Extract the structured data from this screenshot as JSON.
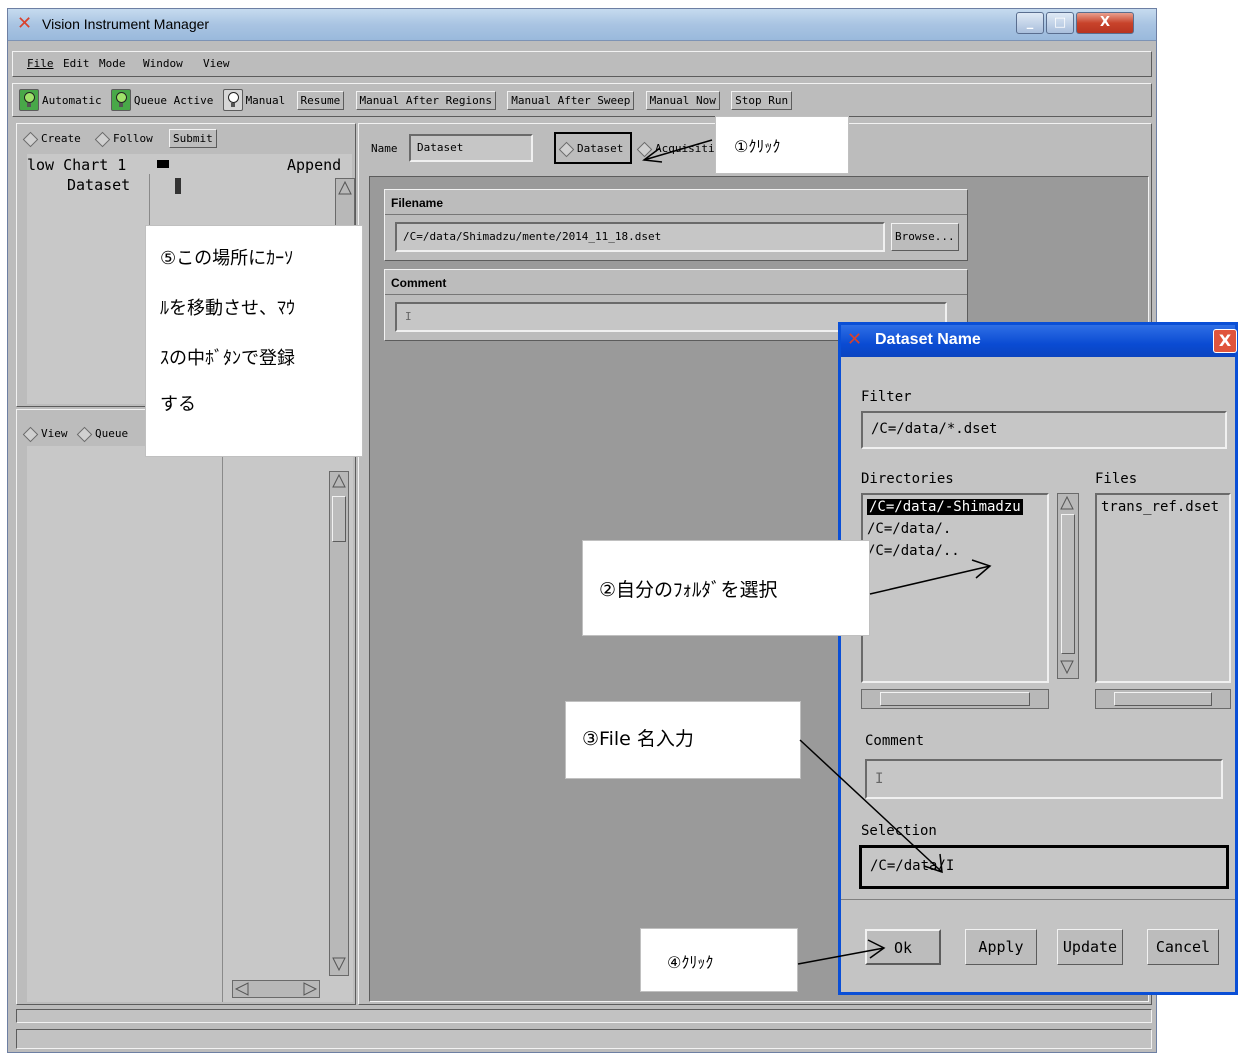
{
  "window": {
    "title": "Vision Instrument Manager",
    "buttons": {
      "minimize": "_",
      "maximize": "□",
      "close": "X"
    }
  },
  "menu": [
    "File",
    "Edit",
    "Mode",
    "Window",
    "View"
  ],
  "toolbar": {
    "automatic": "Automatic",
    "queue_active": "Queue Active",
    "manual": "Manual",
    "resume": "Resume",
    "manual_after_regions": "Manual After Regions",
    "manual_after_sweep": "Manual After Sweep",
    "manual_now": "Manual Now",
    "stop_run": "Stop Run"
  },
  "left_top": {
    "create": "Create",
    "follow": "Follow",
    "submit": "Submit",
    "list_items": [
      {
        "name": "low Chart 1",
        "value": "Append"
      },
      {
        "name": "Dataset",
        "value": ""
      }
    ]
  },
  "left_bottom": {
    "view": "View",
    "queue": "Queue"
  },
  "editor": {
    "name_label": "Name",
    "name_value": "Dataset",
    "dataset_radio": "Dataset",
    "acquisition_radio": "Acquisiti",
    "filename_title": "Filename",
    "filename_value": "/C=/data/Shimadzu/mente/2014_11_18.dset",
    "browse": "Browse...",
    "comment_title": "Comment",
    "comment_value": "I"
  },
  "dialog": {
    "title": "Dataset Name",
    "close": "X",
    "filter_label": "Filter",
    "filter_value": "/C=/data/*.dset",
    "directories_label": "Directories",
    "directories": [
      "/C=/data/-Shimadzu",
      "/C=/data/.",
      "/C=/data/.."
    ],
    "files_label": "Files",
    "files": [
      "trans_ref.dset"
    ],
    "comment_label": "Comment",
    "comment_value": "I",
    "selection_label": "Selection",
    "selection_value": "/C=/data/I",
    "ok": "Ok",
    "apply": "Apply",
    "update": "Update",
    "cancel": "Cancel"
  },
  "notes": {
    "n1": "①ｸﾘｯｸ",
    "n2": "②自分のﾌｫﾙﾀﾞを選択",
    "n3": "③File 名入力",
    "n4": "④ｸﾘｯｸ",
    "n5": [
      "⑤この場所にｶｰｿ",
      "ﾙを移動させ、ﾏｳ",
      "ｽの中ﾎﾞﾀﾝで登録",
      "する"
    ]
  },
  "colors": {
    "accent": "#0a4fd6",
    "bulb_on": "#48a848",
    "selection_bg": "#000000"
  }
}
